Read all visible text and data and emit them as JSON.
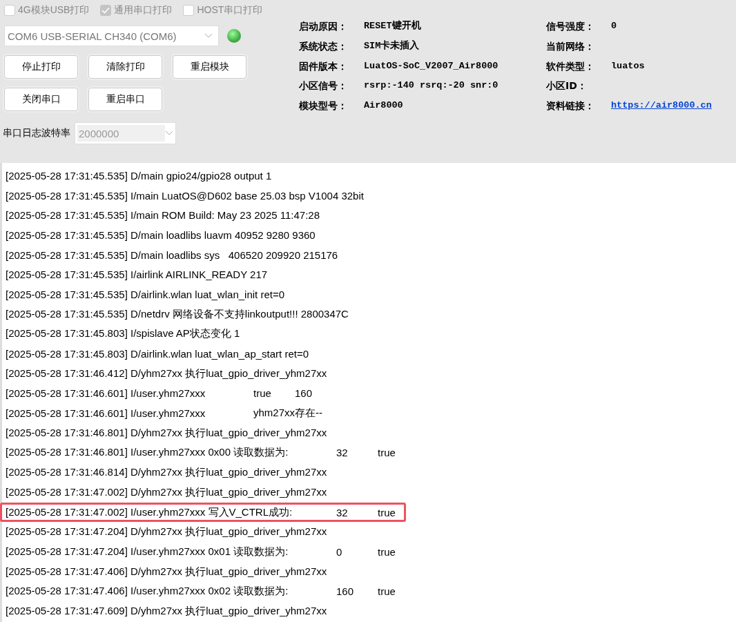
{
  "print_options": [
    {
      "label": "4G模块USB打印",
      "checked": false
    },
    {
      "label": "通用串口打印",
      "checked": true
    },
    {
      "label": "HOST串口打印",
      "checked": false
    }
  ],
  "port_select": {
    "value": "COM6 USB-SERIAL CH340 (COM6)"
  },
  "status_led": {
    "on": true
  },
  "buttons": [
    [
      "停止打印",
      "清除打印",
      "重启模块"
    ],
    [
      "关闭串口",
      "重启串口"
    ]
  ],
  "baud_rate": {
    "label": "串口日志波特率",
    "value": "2000000"
  },
  "info": [
    [
      {
        "label": "启动原因：",
        "value": "RESET键开机"
      },
      {
        "label": "信号强度：",
        "value": "0"
      }
    ],
    [
      {
        "label": "系统状态：",
        "value": "SIM卡未插入"
      },
      {
        "label": "当前网络："
      }
    ],
    [
      {
        "label": "固件版本：",
        "value": "LuatOS-SoC_V2007_Air8000"
      },
      {
        "label": "软件类型：",
        "value": "luatos"
      }
    ],
    [
      {
        "label": "小区信号：",
        "value": "rsrp:-140 rsrq:-20 snr:0"
      },
      {
        "label": "小区ID："
      }
    ],
    [
      {
        "label": "模块型号：",
        "value": "Air8000"
      },
      {
        "label": "资料链接：",
        "value": "https://air8000.cn",
        "kind": "link"
      }
    ]
  ],
  "log": [
    {
      "kind": "plain",
      "highlighted": false,
      "parts": [
        "[2025-05-28 17:31:45.535] D/main gpio24/gpio28 output 1"
      ]
    },
    {
      "kind": "plain",
      "highlighted": false,
      "parts": [
        "[2025-05-28 17:31:45.535] I/main LuatOS@D602 base 25.03 bsp V1004 32bit"
      ]
    },
    {
      "kind": "plain",
      "highlighted": false,
      "parts": [
        "[2025-05-28 17:31:45.535] I/main ROM Build: May 23 2025 11:47:28"
      ]
    },
    {
      "kind": "plain",
      "highlighted": false,
      "parts": [
        "[2025-05-28 17:31:45.535] D/main loadlibs luavm 40952 9280 9360"
      ]
    },
    {
      "kind": "plain",
      "highlighted": false,
      "parts": [
        "[2025-05-28 17:31:45.535] D/main loadlibs sys   406520 209920 215176"
      ]
    },
    {
      "kind": "plain",
      "highlighted": false,
      "parts": [
        "[2025-05-28 17:31:45.535] I/airlink AIRLINK_READY 217"
      ]
    },
    {
      "kind": "plain",
      "highlighted": false,
      "parts": [
        "[2025-05-28 17:31:45.535] D/airlink.wlan luat_wlan_init ret=0"
      ]
    },
    {
      "kind": "plain",
      "highlighted": false,
      "parts": [
        "[2025-05-28 17:31:45.535] D/netdrv 网络设备不支持linkoutput!!! 2800347C"
      ]
    },
    {
      "kind": "plain",
      "highlighted": false,
      "parts": [
        "[2025-05-28 17:31:45.803] I/spislave AP状态变化 1"
      ]
    },
    {
      "kind": "plain",
      "highlighted": false,
      "parts": [
        "[2025-05-28 17:31:45.803] D/airlink.wlan luat_wlan_ap_start ret=0"
      ]
    },
    {
      "kind": "plain",
      "highlighted": false,
      "parts": [
        "[2025-05-28 17:31:46.412] D/yhm27xx 执行luat_gpio_driver_yhm27xx"
      ]
    },
    {
      "kind": "short",
      "highlighted": false,
      "parts": [
        "[2025-05-28 17:31:46.601] I/user.yhm27xxx",
        "true",
        "160"
      ]
    },
    {
      "kind": "short",
      "highlighted": false,
      "parts": [
        "[2025-05-28 17:31:46.601] I/user.yhm27xxx",
        "yhm27xx存在--"
      ]
    },
    {
      "kind": "plain",
      "highlighted": false,
      "parts": [
        "[2025-05-28 17:31:46.801] D/yhm27xx 执行luat_gpio_driver_yhm27xx"
      ]
    },
    {
      "kind": "long",
      "highlighted": false,
      "parts": [
        "[2025-05-28 17:31:46.801] I/user.yhm27xxx 0x00 读取数据为:",
        "32",
        "true"
      ]
    },
    {
      "kind": "plain",
      "highlighted": false,
      "parts": [
        "[2025-05-28 17:31:46.814] D/yhm27xx 执行luat_gpio_driver_yhm27xx"
      ]
    },
    {
      "kind": "plain",
      "highlighted": false,
      "parts": [
        "[2025-05-28 17:31:47.002] D/yhm27xx 执行luat_gpio_driver_yhm27xx"
      ]
    },
    {
      "kind": "long",
      "highlighted": true,
      "parts": [
        "[2025-05-28 17:31:47.002] I/user.yhm27xxx 写入V_CTRL成功:",
        "32",
        "true"
      ]
    },
    {
      "kind": "plain",
      "highlighted": false,
      "parts": [
        "[2025-05-28 17:31:47.204] D/yhm27xx 执行luat_gpio_driver_yhm27xx"
      ]
    },
    {
      "kind": "long",
      "highlighted": false,
      "parts": [
        "[2025-05-28 17:31:47.204] I/user.yhm27xxx 0x01 读取数据为:",
        "0",
        "true"
      ]
    },
    {
      "kind": "plain",
      "highlighted": false,
      "parts": [
        "[2025-05-28 17:31:47.406] D/yhm27xx 执行luat_gpio_driver_yhm27xx"
      ]
    },
    {
      "kind": "long",
      "highlighted": false,
      "parts": [
        "[2025-05-28 17:31:47.406] I/user.yhm27xxx 0x02 读取数据为:",
        "160",
        "true"
      ]
    },
    {
      "kind": "plain",
      "highlighted": false,
      "parts": [
        "[2025-05-28 17:31:47.609] D/yhm27xx 执行luat_gpio_driver_yhm27xx"
      ]
    }
  ]
}
